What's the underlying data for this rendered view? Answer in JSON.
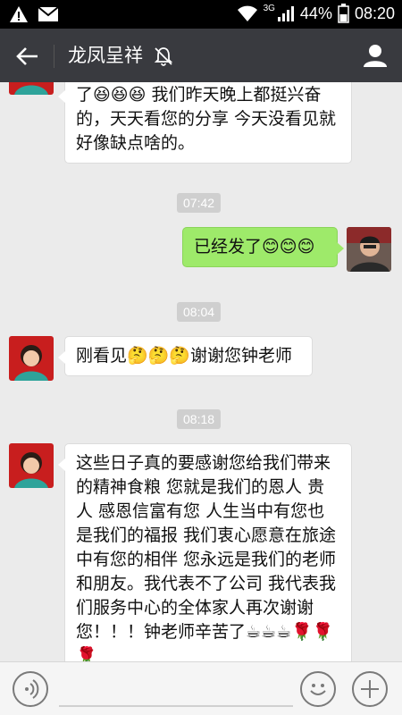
{
  "status_bar": {
    "network": "3G",
    "battery": "44%",
    "time": "08:20"
  },
  "header": {
    "title": "龙凤呈祥"
  },
  "messages": {
    "m1": {
      "text": "了😆😆😆 我们昨天晚上都挺兴奋的，天天看您的分享 今天没看见就好像缺点啥的。"
    },
    "t1": "07:42",
    "m2": {
      "text": "已经发了😊😊😊"
    },
    "t2": "08:04",
    "m3": {
      "text": "刚看见🤔🤔🤔谢谢您钟老师"
    },
    "t3": "08:18",
    "m4": {
      "text": "这些日子真的要感谢您给我们带来的精神食粮 您就是我们的恩人 贵人 感恩信富有您 人生当中有您也是我们的福报 我们衷心愿意在旅途中有您的相伴 您永远是我们的老师和朋友。我代表不了公司 我代表我们服务中心的全体家人再次谢谢您！！！钟老师辛苦了☕☕☕🌹🌹🌹"
    }
  },
  "input": {
    "placeholder": ""
  },
  "colors": {
    "titlebar": "#393a3f",
    "chat_bg": "#ebebeb",
    "sent_bubble": "#9eea6a",
    "received_bubble": "#ffffff"
  }
}
